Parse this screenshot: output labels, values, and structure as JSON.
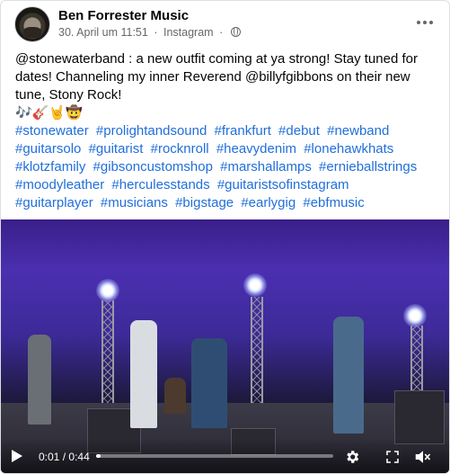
{
  "post": {
    "page_name": "Ben Forrester Music",
    "date": "30. April um 11:51",
    "separator": "·",
    "source": "Instagram",
    "text_line1": "@stonewaterband : a new outfit coming at ya strong! Stay tuned for dates! Channeling my inner Reverend @billyfgibbons on their new tune, Stony Rock!",
    "emojis": "🎶🎸🤘🤠",
    "hashtags": [
      "#stonewater",
      "#prolightandsound",
      "#frankfurt",
      "#debut",
      "#newband",
      "#guitarsolo",
      "#guitarist",
      "#rocknroll",
      "#heavydenim",
      "#lonehawkhats",
      "#klotzfamily",
      "#gibsoncustomshop",
      "#marshallamps",
      "#ernieballstrings",
      "#moodyleather",
      "#herculesstands",
      "#guitaristsofinstagram",
      "#guitarplayer",
      "#musicians",
      "#bigstage",
      "#earlygig",
      "#ebfmusic"
    ]
  },
  "video": {
    "current_time": "0:01",
    "time_separator": "/",
    "duration": "0:44",
    "progress_fraction": 0.02
  },
  "icons": {
    "more": "more-horizontal-icon",
    "globe": "globe-icon",
    "play": "play-icon",
    "settings": "gear-icon",
    "fullscreen": "expand-icon",
    "volume": "speaker-muted-icon"
  }
}
